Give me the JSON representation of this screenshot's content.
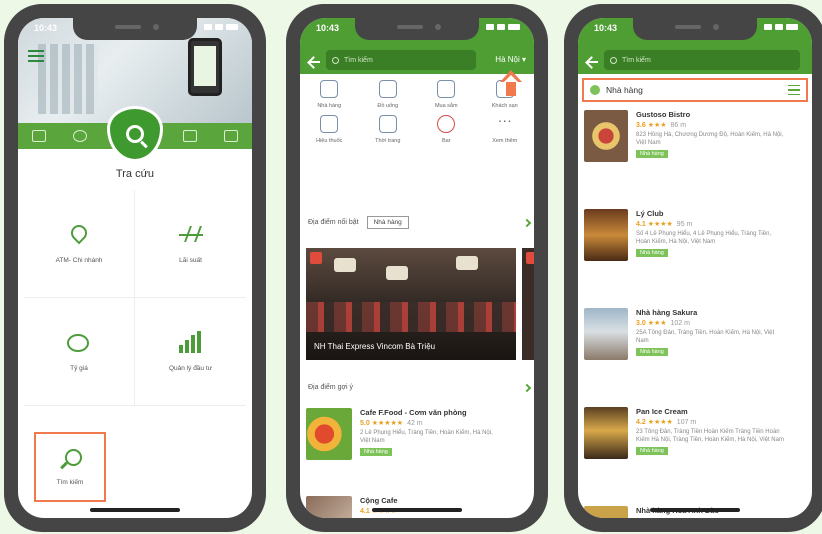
{
  "status": {
    "time": "10:43"
  },
  "phone1": {
    "title": "Tra cứu",
    "tiles": [
      {
        "label": "ATM- Chi nhánh",
        "icon": "map-pin-icon"
      },
      {
        "label": "Lãi suất",
        "icon": "pulse-chart-icon"
      },
      {
        "label": "Tỷ giá",
        "icon": "exchange-coin-icon"
      },
      {
        "label": "Quản lý đầu tư",
        "icon": "bar-chart-icon"
      }
    ],
    "highlight_label": "Tìm kiếm"
  },
  "phone2": {
    "search_placeholder": "Tìm kiếm",
    "city": "Hà Nội",
    "categories": [
      {
        "label": "Nhà hàng"
      },
      {
        "label": "Đồ uống"
      },
      {
        "label": "Mua sắm"
      },
      {
        "label": "Khách sạn"
      },
      {
        "label": "Hiệu thuốc"
      },
      {
        "label": "Thời trang"
      },
      {
        "label": "Bar"
      },
      {
        "label": "Xem thêm"
      }
    ],
    "featured_title": "Địa điểm nổi bật",
    "featured_filter": "Nhà hàng",
    "banner_text": "NH Thai Express Vincom Bà Triệu",
    "suggest_title": "Địa điểm gợi ý",
    "suggestions": [
      {
        "name": "Cafe F.Food - Cơm văn phòng",
        "score": "5.0",
        "stars": "★★★★★",
        "distance": "42 m",
        "address": "2 Lê Phụng Hiểu, Tràng Tiền, Hoàn Kiếm, Hà Nội, Việt Nam",
        "tag": "Nhà hàng"
      },
      {
        "name": "Cộng Cafe",
        "score": "4.1",
        "stars": "★★★★",
        "distance": "",
        "address": "",
        "tag": ""
      }
    ]
  },
  "phone3": {
    "search_placeholder": "Tìm kiếm",
    "filter_label": "Nhà hàng",
    "restaurants": [
      {
        "name": "Gustoso Bistro",
        "score": "3.6",
        "stars": "★★★",
        "distance": "86 m",
        "address": "823 Hồng Hà, Chương Dương Độ, Hoàn Kiếm, Hà Nội, Việt Nam",
        "tag": "Nhà hàng"
      },
      {
        "name": "Lý Club",
        "score": "4.1",
        "stars": "★★★★",
        "distance": "95 m",
        "address": "Số 4 Lê Phụng Hiểu, 4 Lê Phụng Hiểu, Tràng Tiền, Hoàn Kiếm, Hà Nội, Việt Nam",
        "tag": "Nhà hàng"
      },
      {
        "name": "Nhà hàng Sakura",
        "score": "3.0",
        "stars": "★★★",
        "distance": "102 m",
        "address": "25A Tông Đản, Tràng Tiền, Hoàn Kiếm, Hà Nội, Việt Nam",
        "tag": "Nhà hàng"
      },
      {
        "name": "Pan Ice Cream",
        "score": "4.2",
        "stars": "★★★★",
        "distance": "107 m",
        "address": "23 Tông Đản, Tràng Tiền Hoàn Kiếm Tràng Tiền Hoàn Kiếm Hà Nội, Tràng Tiền, Hoàn Kiếm, Hà Nội, Việt Nam",
        "tag": "Nhà hàng"
      },
      {
        "name": "Nhà hàng Hoa Anh Đào",
        "score": "",
        "stars": "",
        "distance": "",
        "address": "",
        "tag": ""
      }
    ]
  }
}
